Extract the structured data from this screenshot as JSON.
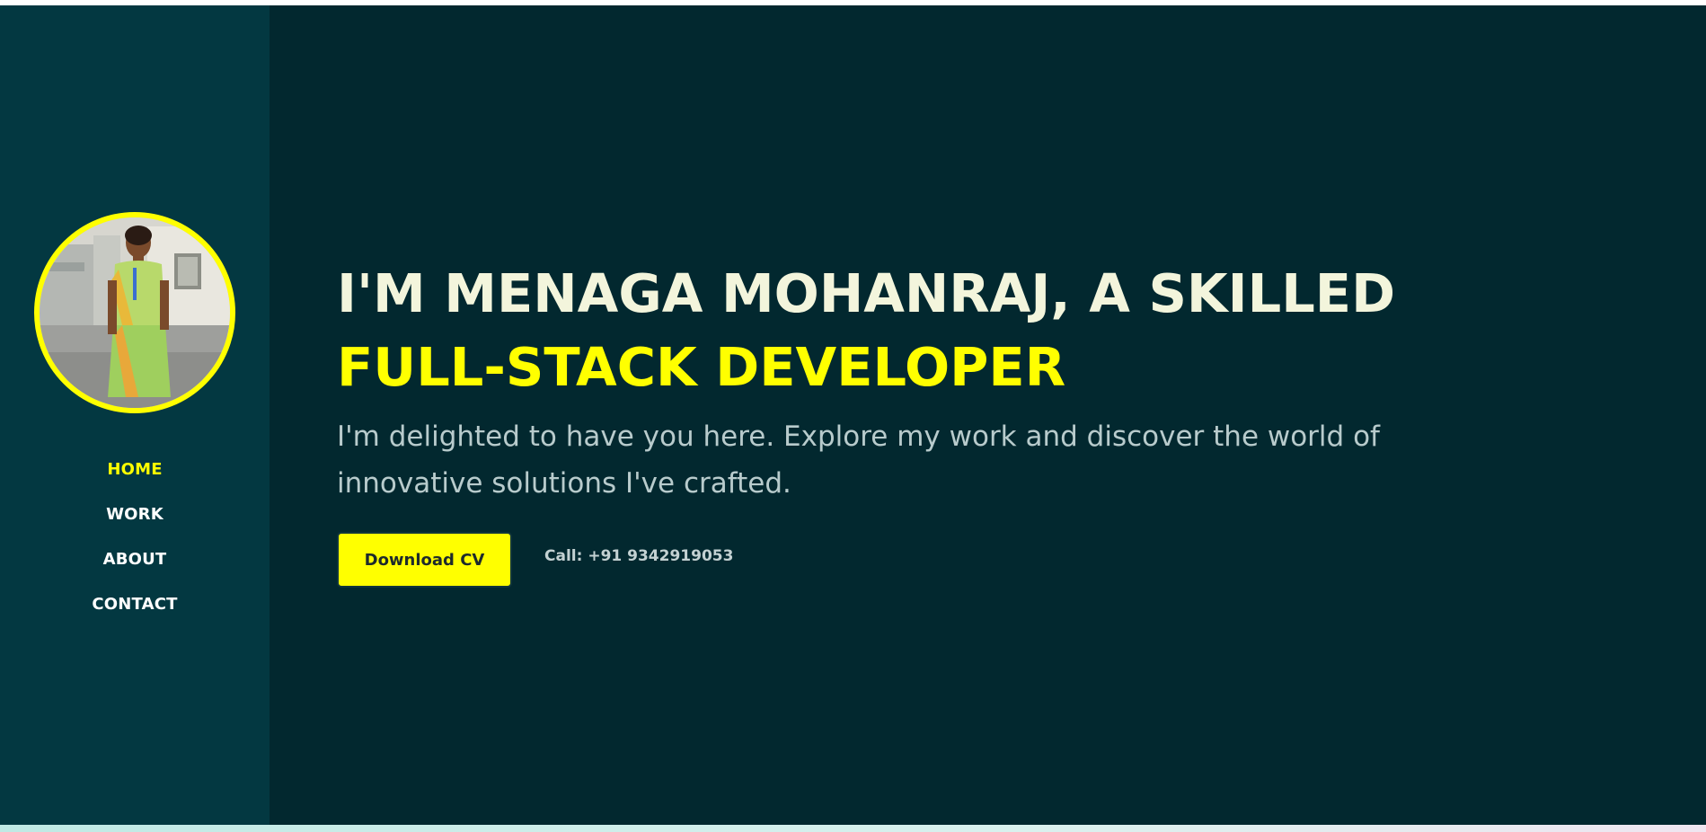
{
  "sidebar": {
    "nav": [
      {
        "label": "HOME",
        "active": true
      },
      {
        "label": "WORK",
        "active": false
      },
      {
        "label": "ABOUT",
        "active": false
      },
      {
        "label": "CONTACT",
        "active": false
      }
    ]
  },
  "hero": {
    "headline_line1": "I'M MENAGA MOHANRAJ, A SKILLED",
    "headline_line2": "FULL-STACK DEVELOPER",
    "subtitle": "I'm delighted to have you here. Explore my work and discover the world of innovative solutions I've crafted.",
    "download_label": "Download CV",
    "call_text": "Call: +91 9342919053"
  },
  "colors": {
    "background": "#02282f",
    "sidebar": "#033841",
    "accent": "#ffff00",
    "headline": "#f3f5dc",
    "muted_text": "#b8cbcc"
  }
}
